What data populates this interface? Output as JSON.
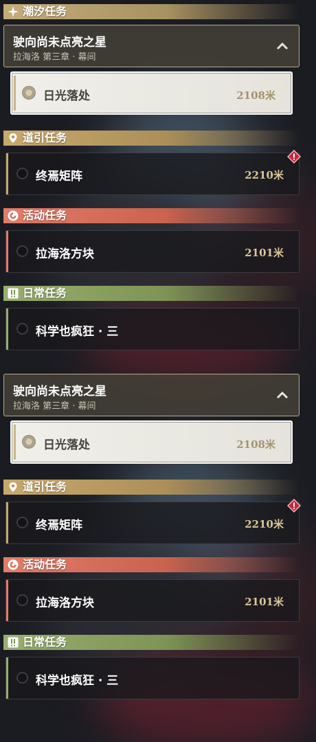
{
  "colors": {
    "tide": "#c4ad79",
    "guide": "#c8a96c",
    "event": "#e27c68",
    "daily": "#98ae6e",
    "distance_active": "#a4946b",
    "distance": "#d9c79a",
    "warning": "#c4283f"
  },
  "icons": {
    "tide": "sparkle-icon",
    "guide": "map-pin-icon",
    "event": "swirl-icon",
    "daily": "exclamation-box-icon",
    "collapse": "chevron-up-icon",
    "warning": "diamond-warning-icon"
  },
  "tide_category": {
    "label": "潮汐任务"
  },
  "main_quest": {
    "title": "驶向尚未点亮之星",
    "subtitle": "拉海洛 第三章 · 幕间",
    "active_step": {
      "name": "日光落处",
      "distance": "2108米"
    }
  },
  "guide_category": {
    "label": "道引任务",
    "quest": {
      "name": "终焉矩阵",
      "distance": "2210米"
    }
  },
  "event_category": {
    "label": "活动任务",
    "quest": {
      "name": "拉海洛方块",
      "distance": "2101米"
    }
  },
  "daily_category": {
    "label": "日常任务",
    "quest": {
      "name": "科学也疯狂 · 三"
    }
  }
}
